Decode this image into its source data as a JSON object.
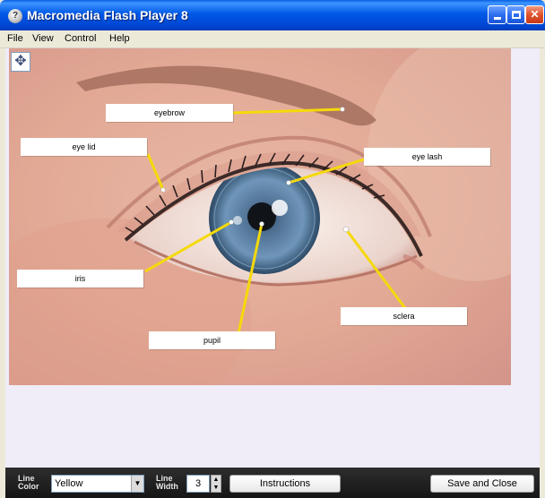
{
  "window": {
    "title": "Macromedia Flash Player 8",
    "icon": "flash-player-icon",
    "controls": [
      "minimize-icon",
      "maximize-icon",
      "close-icon"
    ]
  },
  "menu": {
    "items": [
      "File",
      "View",
      "Control",
      "Help"
    ]
  },
  "diagram": {
    "labels": {
      "eyebrow": "eyebrow",
      "eye_lid": "eye lid",
      "eye_lash": "eye lash",
      "iris": "iris",
      "sclera": "sclera",
      "pupil": "pupil"
    },
    "line_color": "#f5d90a"
  },
  "toolbar": {
    "line_color_label_1": "Line",
    "line_color_label_2": "Color",
    "line_color_value": "Yellow",
    "line_width_label_1": "Line",
    "line_width_label_2": "Width",
    "line_width_value": "3",
    "instructions_label": "Instructions",
    "save_close_label": "Save and Close"
  }
}
